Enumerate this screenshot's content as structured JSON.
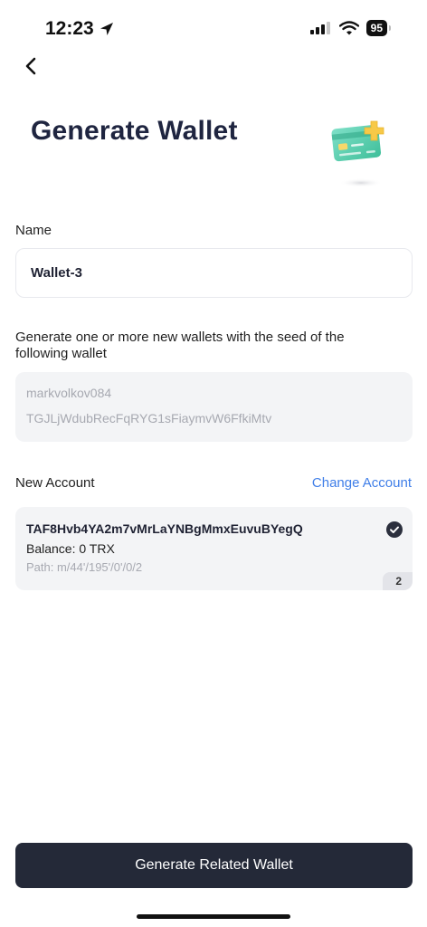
{
  "status_bar": {
    "time": "12:23",
    "battery": "95"
  },
  "header": {
    "title": "Generate Wallet"
  },
  "name_section": {
    "label": "Name",
    "value": "Wallet-3"
  },
  "seed_section": {
    "description": "Generate one or more new wallets with the seed of the following wallet",
    "wallet_name": "markvolkov084",
    "wallet_address": "TGJLjWdubRecFqRYG1sFiaymvW6FfkiMtv"
  },
  "account_section": {
    "label": "New Account",
    "change_label": "Change Account",
    "account": {
      "address": "TAF8Hvb4YA2m7vMrLaYNBgMmxEuvuBYegQ",
      "balance": "Balance: 0 TRX",
      "path": "Path: m/44'/195'/0'/0/2",
      "index": "2"
    }
  },
  "footer": {
    "primary_button": "Generate Related Wallet"
  },
  "colors": {
    "primary": "#242938",
    "link": "#3f7ee8",
    "card_bg": "#f3f4f6"
  }
}
